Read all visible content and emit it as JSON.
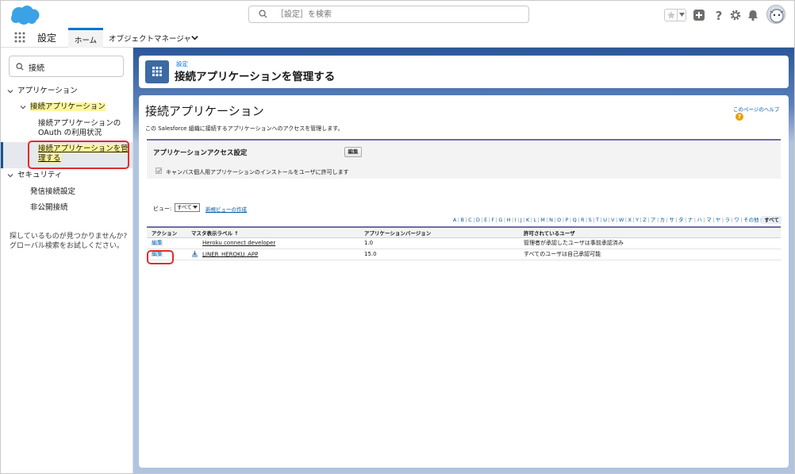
{
  "header": {
    "search_placeholder": "［設定］を検索"
  },
  "nav": {
    "app_name": "設定",
    "tabs": [
      {
        "label": "ホーム"
      },
      {
        "label": "オブジェクトマネージャ"
      }
    ]
  },
  "sidebar": {
    "quick_find_value": "接続",
    "items": [
      {
        "label": "アプリケーション"
      },
      {
        "label": "接続アプリケーション"
      },
      {
        "label": "接続アプリケーションの OAuth の利用状況"
      },
      {
        "label": "接続アプリケーションを管理する"
      },
      {
        "label": "セキュリティ"
      },
      {
        "label": "発信接続設定"
      },
      {
        "label": "非公開接続"
      }
    ],
    "not_found_text": "探しているものが見つかりませんか? グローバル検索をお試しください。"
  },
  "page_header": {
    "breadcrumb": "設定",
    "title": "接続アプリケーションを管理する"
  },
  "content": {
    "title": "接続アプリケーション",
    "help_link": "このページのヘルプ",
    "description": "この Salesforce 組織に接続するアプリケーションへのアクセスを管理します。",
    "section": {
      "title": "アプリケーションアクセス設定",
      "edit_label": "編集",
      "checkbox_label": "キャンバス個人用アプリケーションのインストールをユーザに許可します"
    },
    "view": {
      "label": "ビュー:",
      "selected": "すべて",
      "new_view_link": "新規ビューの作成"
    },
    "alpha_filter": [
      "A",
      "B",
      "C",
      "D",
      "E",
      "F",
      "G",
      "H",
      "I",
      "J",
      "K",
      "L",
      "M",
      "N",
      "O",
      "P",
      "Q",
      "R",
      "S",
      "T",
      "U",
      "V",
      "W",
      "X",
      "Y",
      "Z",
      "ア",
      "カ",
      "サ",
      "タ",
      "ナ",
      "ハ",
      "マ",
      "ヤ",
      "ラ",
      "ワ",
      "その他",
      "すべて"
    ],
    "table": {
      "headers": [
        "アクション",
        "マスタ表示ラベル ↑",
        "アプリケーションバージョン",
        "許可されているユーザ"
      ],
      "rows": [
        {
          "action": "編集",
          "label": "Heroku connect developer",
          "version": "1.0",
          "users": "管理者が承認したユーザは事前承認済み",
          "has_icon": false
        },
        {
          "action": "編集",
          "label": "LINER_HEROKU_APP",
          "version": "15.0",
          "users": "すべてのユーザは自己承認可能",
          "has_icon": true
        }
      ]
    }
  },
  "colors": {
    "brand_blue": "#0176d3",
    "header_band": "#2b5797",
    "highlight": "#fff59d",
    "callout_red": "#e42b2b"
  }
}
